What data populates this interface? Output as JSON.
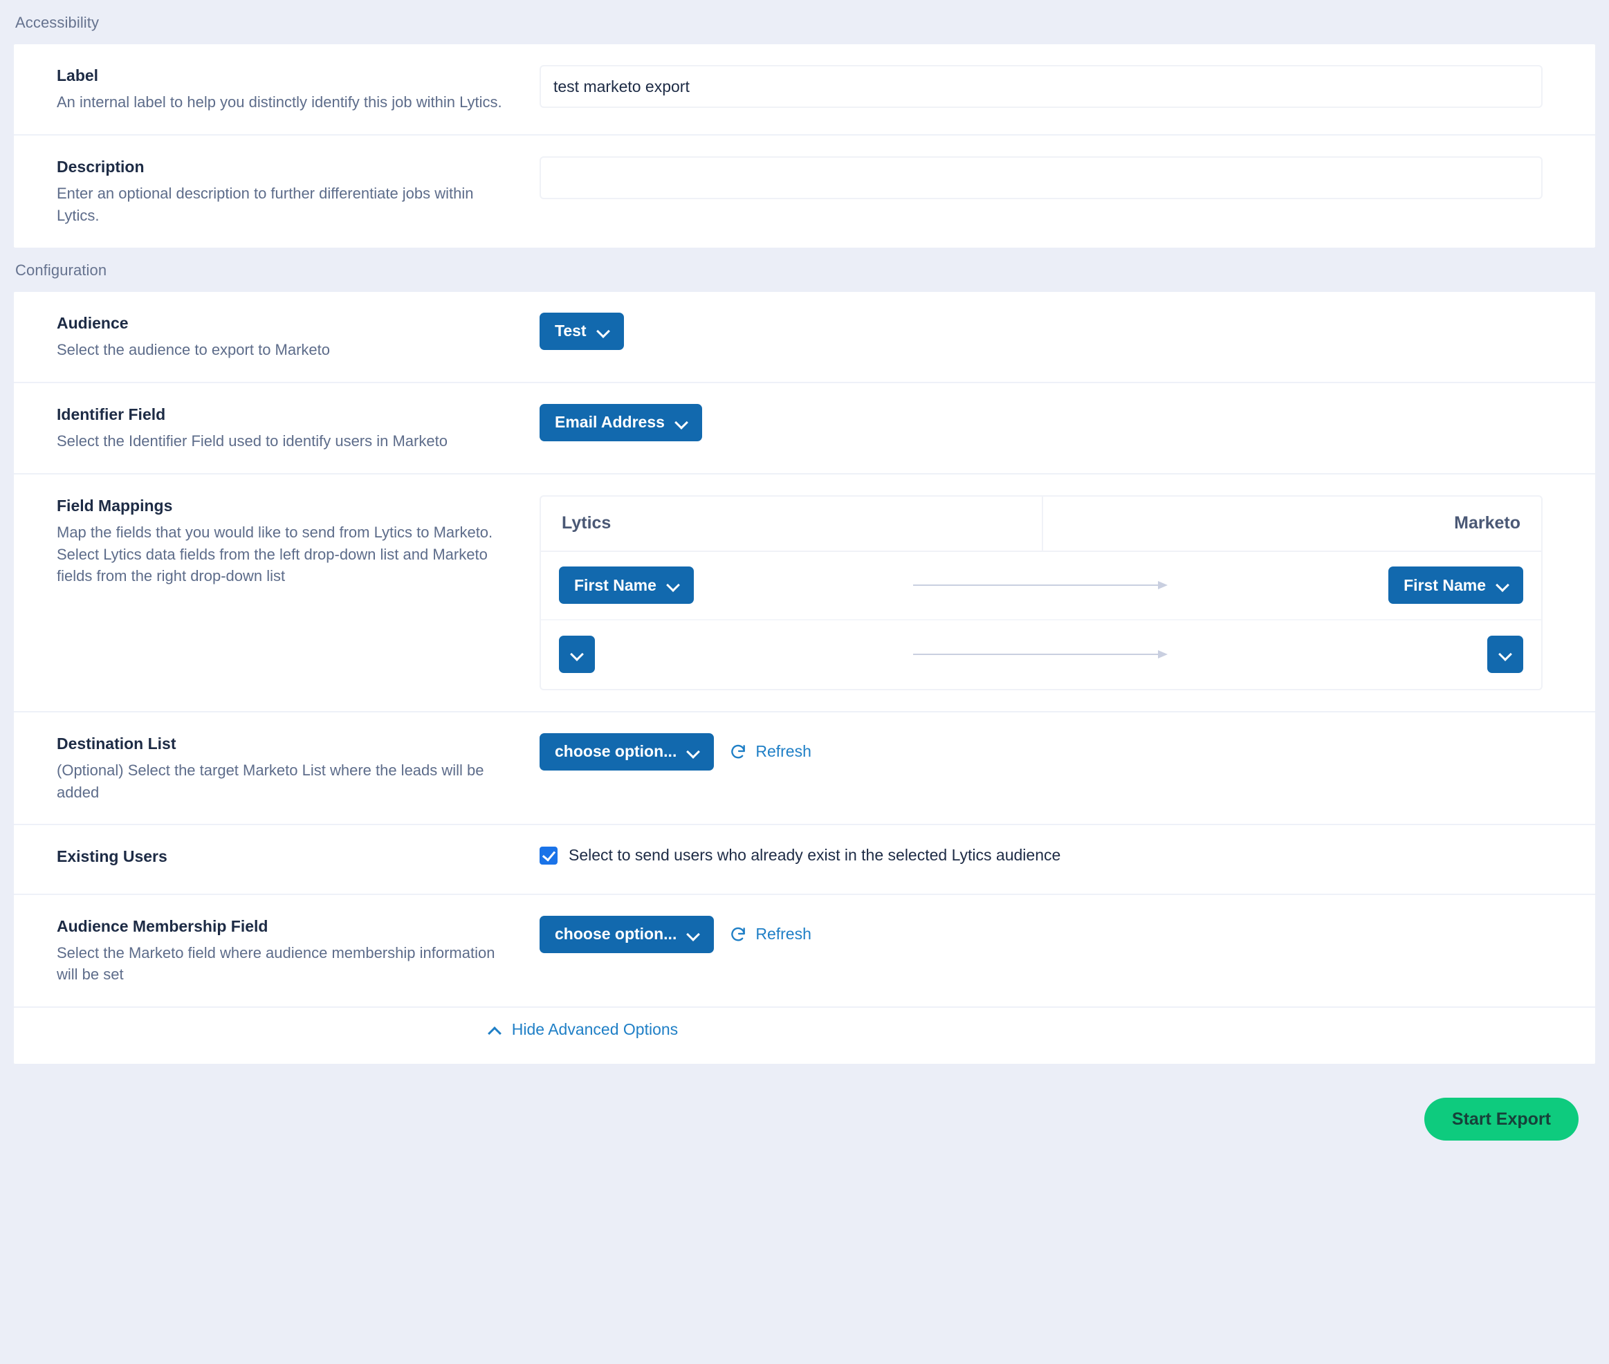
{
  "sections": [
    {
      "id": "accessibility",
      "title": "Accessibility"
    },
    {
      "id": "configuration",
      "title": "Configuration"
    }
  ],
  "accessibility": {
    "label_field": {
      "title": "Label",
      "description": "An internal label to help you distinctly identify this job within Lytics.",
      "value": "test marketo export",
      "placeholder": ""
    },
    "description_field": {
      "title": "Description",
      "description": "Enter an optional description to further differentiate jobs within Lytics.",
      "value": "",
      "placeholder": ""
    }
  },
  "configuration": {
    "audience": {
      "title": "Audience",
      "description": "Select the audience to export to Marketo",
      "selected": "Test"
    },
    "identifier_field": {
      "title": "Identifier Field",
      "description": "Select the Identifier Field used to identify users in Marketo",
      "selected": "Email Address"
    },
    "field_mappings": {
      "title": "Field Mappings",
      "description": "Map the fields that you would like to send from Lytics to Marketo. Select Lytics data fields from the left drop-down list and Marketo fields from the right drop-down list",
      "columns": {
        "left": "Lytics",
        "right": "Marketo"
      },
      "rows": [
        {
          "lytics": "First Name",
          "marketo": "First Name"
        },
        {
          "lytics": "",
          "marketo": ""
        }
      ]
    },
    "destination_list": {
      "title": "Destination List",
      "description": "(Optional) Select the target Marketo List where the leads will be added",
      "selected": "choose option...",
      "refresh_label": "Refresh"
    },
    "existing_users": {
      "title": "Existing Users",
      "checkbox_label": "Select to send users who already exist in the selected Lytics audience",
      "checked": true
    },
    "audience_membership_field": {
      "title": "Audience Membership Field",
      "description": "Select the Marketo field where audience membership information will be set",
      "selected": "choose option...",
      "refresh_label": "Refresh"
    },
    "advanced_toggle": {
      "label": "Hide Advanced Options"
    }
  },
  "footer": {
    "start_export_label": "Start Export"
  },
  "colors": {
    "page_bg": "#ebeef7",
    "primary_blue": "#1269ae",
    "link_blue": "#1f7fc6",
    "checkbox_blue": "#1a73e8",
    "start_green": "#0ecb7e",
    "heading_text": "#1d2b45",
    "muted_text": "#5d6c8a"
  },
  "icons": {
    "chevron_down": "chevron-down-icon",
    "chevron_up": "chevron-up-icon",
    "refresh": "refresh-icon",
    "check": "check-icon",
    "arrow_right": "arrow-right-icon"
  }
}
